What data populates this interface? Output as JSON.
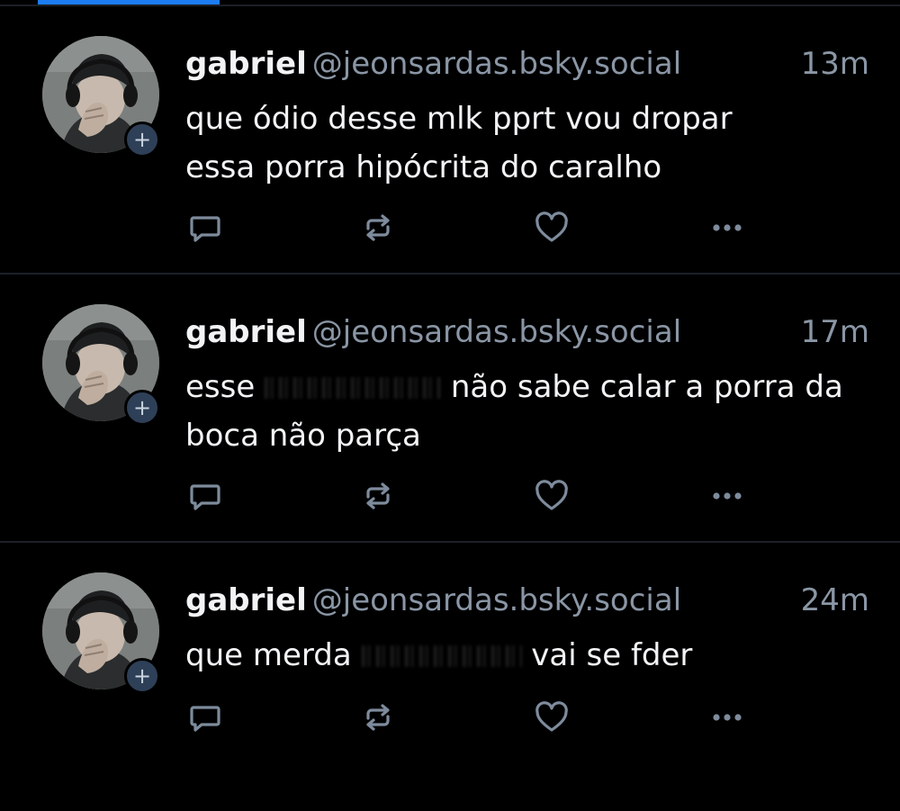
{
  "posts": [
    {
      "author_name": "gabriel",
      "author_handle": "@jeonsardas.bsky.social",
      "timestamp": "13m",
      "text_before": "que ódio desse mlk pprt vou dropar\nessa porra hipócrita do caralho",
      "redacted": false,
      "text_after": ""
    },
    {
      "author_name": "gabriel",
      "author_handle": "@jeonsardas.bsky.social",
      "timestamp": "17m",
      "text_before": "esse ",
      "redacted": true,
      "text_after": " não sabe calar a porra da\nboca não parça"
    },
    {
      "author_name": "gabriel",
      "author_handle": "@jeonsardas.bsky.social",
      "timestamp": "24m",
      "text_before": "que merda ",
      "redacted": true,
      "text_after": " vai se fder"
    }
  ],
  "follow_badge": "+",
  "icons": {
    "reply": "reply-icon",
    "repost": "repost-icon",
    "like": "like-icon",
    "more": "more-icon"
  },
  "colors": {
    "background": "#000000",
    "text": "#f1f3f5",
    "muted": "#8a96a5",
    "icon": "#7d8b9c",
    "accent": "#1d7cf2",
    "divider": "#1c2128",
    "badge": "#2e4057"
  }
}
